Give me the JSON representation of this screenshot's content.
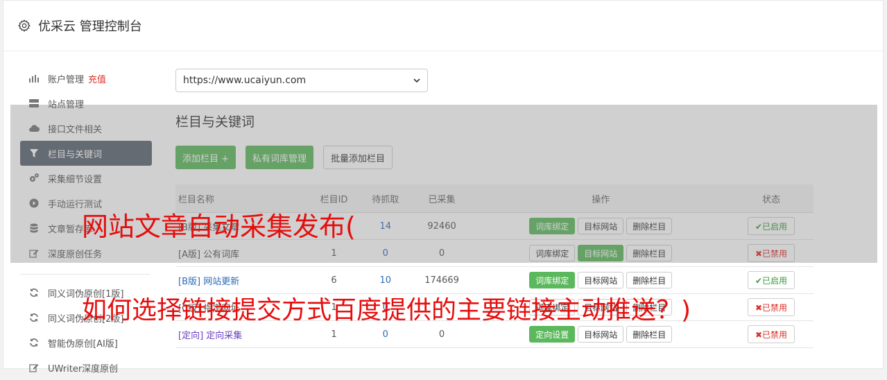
{
  "header": {
    "title": "优采云 管理控制台",
    "icon": "gear-icon"
  },
  "sidebar": {
    "items": [
      {
        "label": "账户管理",
        "extra": "充值",
        "icon": "bar-chart-icon"
      },
      {
        "label": "站点管理",
        "icon": "server-icon"
      },
      {
        "label": "接口文件相关",
        "icon": "cloud-upload-icon"
      },
      {
        "label": "栏目与关键词",
        "icon": "filter-icon",
        "active": true
      },
      {
        "label": "采集细节设置",
        "icon": "gears-icon"
      },
      {
        "label": "手动运行测试",
        "icon": "play-icon"
      },
      {
        "label": "文章暂存库",
        "icon": "database-icon"
      },
      {
        "label": "深度原创任务",
        "icon": "edit-icon"
      }
    ],
    "items2": [
      {
        "label": "同义词伪原创[1版]",
        "icon": "refresh-icon"
      },
      {
        "label": "同义词伪原创[2版]",
        "icon": "refresh-icon"
      },
      {
        "label": "智能伪原创[AI版]",
        "icon": "refresh-icon"
      },
      {
        "label": "UWriter深度原创",
        "icon": "edit-icon"
      }
    ]
  },
  "main": {
    "site_select": "https://www.ucaiyun.com",
    "section_title": "栏目与关键词",
    "buttons": {
      "add": "添加栏目 +",
      "private": "私有词库管理",
      "batch": "批量添加栏目"
    },
    "table": {
      "headers": [
        "栏目名称",
        "栏目ID",
        "待抓取",
        "已采集",
        "操作",
        "状态"
      ],
      "rows": [
        {
          "name": "[B版] 采集文章",
          "id": "",
          "pending": "14",
          "collected": "92460",
          "op1": "词库绑定",
          "op2": "目标网站",
          "op3": "删除栏目",
          "status": "✔已启用"
        },
        {
          "name": "[A版] 公有词库",
          "id": "1",
          "pending": "0",
          "collected": "0",
          "op1": "词库绑定",
          "op2": "目标网站",
          "op3": "删除栏目",
          "status": "✖已禁用"
        },
        {
          "name": "[B版] 网站更新",
          "id": "6",
          "pending": "10",
          "collected": "174669",
          "op1": "词库绑定",
          "op2": "目标网站",
          "op3": "删除栏目",
          "status": "✔已启用"
        },
        {
          "name": "[C版] 指定网址",
          "id": "1",
          "pending": "0",
          "collected": "",
          "op1": "词库绑定",
          "op2": "目标网站",
          "op3": "删除栏目",
          "status": "✖已禁用"
        },
        {
          "name": "[定向] 定向采集",
          "id": "1",
          "pending": "0",
          "collected": "0",
          "op1": "定向设置",
          "op2": "目标网站",
          "op3": "删除栏目",
          "status": "✖已禁用"
        }
      ]
    }
  },
  "overlay": {
    "line1": "网站文章自动采集发布(",
    "line2": "如何选择链接提交方式百度提供的主要链接主动推送？)"
  },
  "colors": {
    "accent_green": "#5cb85c",
    "active_nav": "#5b6471",
    "red": "#e60d0d"
  }
}
